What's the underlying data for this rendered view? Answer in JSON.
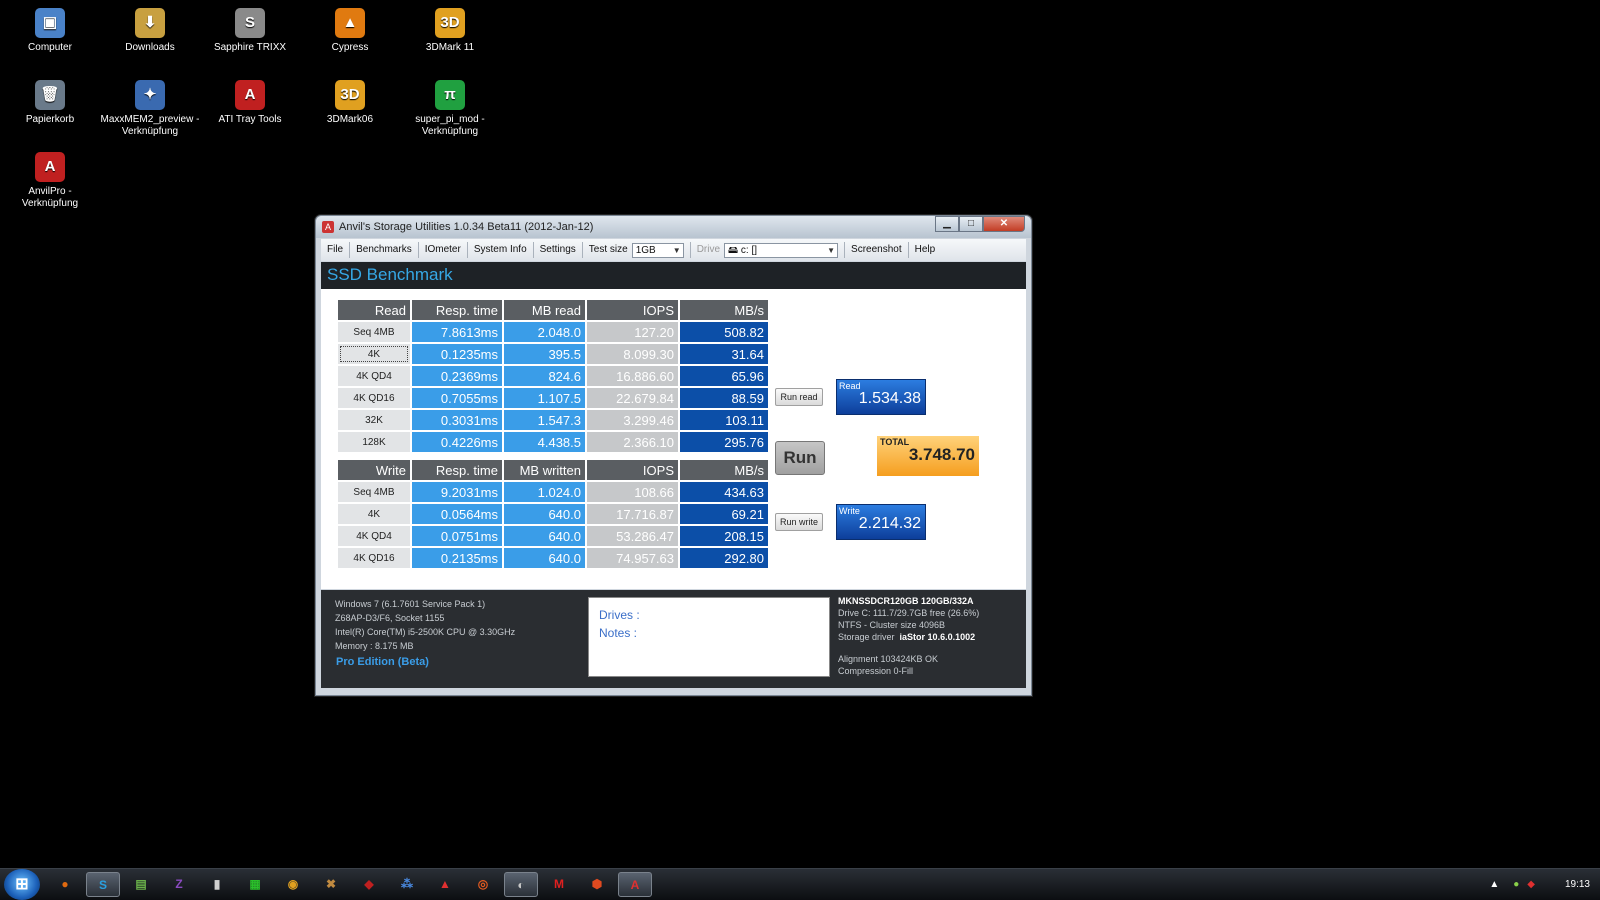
{
  "desktop": {
    "icons": [
      {
        "label": "Computer",
        "glyph": "▣",
        "color": "#4a82c8",
        "icon": "computer-icon"
      },
      {
        "label": "Downloads",
        "glyph": "⬇",
        "color": "#c8a040",
        "icon": "downloads-folder-icon"
      },
      {
        "label": "Sapphire TRIXX",
        "glyph": "S",
        "color": "#8a8a8a",
        "icon": "sapphire-trixx-icon"
      },
      {
        "label": "Cypress",
        "glyph": "▲",
        "color": "#e07a10",
        "icon": "vlc-cone-icon"
      },
      {
        "label": "3DMark 11",
        "glyph": "3D",
        "color": "#e0a020",
        "icon": "3dmark-icon"
      },
      {
        "label": "Papierkorb",
        "glyph": "🗑",
        "color": "#6a7a8a",
        "icon": "recycle-bin-icon"
      },
      {
        "label": "MaxxMEM2_preview - Verknüpfung",
        "glyph": "✦",
        "color": "#3a6ab0",
        "icon": "maxxmem-icon"
      },
      {
        "label": "ATI Tray Tools",
        "glyph": "A",
        "color": "#c02020",
        "icon": "ati-tray-tools-icon"
      },
      {
        "label": "3DMark06",
        "glyph": "3D",
        "color": "#e0a020",
        "icon": "3dmark06-icon"
      },
      {
        "label": "super_pi_mod - Verknüpfung",
        "glyph": "π",
        "color": "#20a040",
        "icon": "super-pi-icon"
      },
      {
        "label": "AnvilPro - Verknüpfung",
        "glyph": "A",
        "color": "#c02020",
        "icon": "anvilpro-icon"
      }
    ]
  },
  "window": {
    "title": "Anvil's Storage Utilities 1.0.34 Beta11 (2012-Jan-12)",
    "min": "▁",
    "max": "□",
    "close": "✕"
  },
  "menu": {
    "file": "File",
    "benchmarks": "Benchmarks",
    "iometer": "IOmeter",
    "sysinfo": "System Info",
    "settings": "Settings",
    "testsize_label": "Test size",
    "testsize_value": "1GB",
    "drive_label": "Drive",
    "drive_value": "c: []",
    "screenshot": "Screenshot",
    "help": "Help"
  },
  "header": {
    "title": "SSD Benchmark"
  },
  "read_table": {
    "headers": [
      "Read",
      "Resp. time",
      "MB read",
      "IOPS",
      "MB/s"
    ],
    "rows": [
      [
        "Seq 4MB",
        "7.8613ms",
        "2.048.0",
        "127.20",
        "508.82"
      ],
      [
        "4K",
        "0.1235ms",
        "395.5",
        "8.099.30",
        "31.64"
      ],
      [
        "4K QD4",
        "0.2369ms",
        "824.6",
        "16.886.60",
        "65.96"
      ],
      [
        "4K QD16",
        "0.7055ms",
        "1.107.5",
        "22.679.84",
        "88.59"
      ],
      [
        "32K",
        "0.3031ms",
        "1.547.3",
        "3.299.46",
        "103.11"
      ],
      [
        "128K",
        "0.4226ms",
        "4.438.5",
        "2.366.10",
        "295.76"
      ]
    ]
  },
  "write_table": {
    "headers": [
      "Write",
      "Resp. time",
      "MB written",
      "IOPS",
      "MB/s"
    ],
    "rows": [
      [
        "Seq 4MB",
        "9.2031ms",
        "1.024.0",
        "108.66",
        "434.63"
      ],
      [
        "4K",
        "0.0564ms",
        "640.0",
        "17.716.87",
        "69.21"
      ],
      [
        "4K QD4",
        "0.0751ms",
        "640.0",
        "53.286.47",
        "208.15"
      ],
      [
        "4K QD16",
        "0.2135ms",
        "640.0",
        "74.957.63",
        "292.80"
      ]
    ]
  },
  "buttons": {
    "run_read": "Run read",
    "run": "Run",
    "run_write": "Run write"
  },
  "scores": {
    "read_label": "Read",
    "read_value": "1.534.38",
    "total_label": "TOTAL",
    "total_value": "3.748.70",
    "write_label": "Write",
    "write_value": "2.214.32"
  },
  "sysinfo": {
    "os": "Windows 7 (6.1.7601 Service Pack 1)",
    "board": "Z68AP-D3/F6, Socket 1155",
    "cpu": "Intel(R) Core(TM) i5-2500K CPU @ 3.30GHz",
    "memory": "Memory : 8.175 MB",
    "edition": "Pro Edition (Beta)"
  },
  "notes": {
    "drives": "Drives :",
    "notes": "Notes :"
  },
  "driveinfo": {
    "model": "MKNSSDCR120GB 120GB/332A",
    "drive": "Drive C: 111.7/29.7GB free (26.6%)",
    "fs": "NTFS - Cluster size 4096B",
    "driver_label": "Storage driver",
    "driver_value": "iaStor 10.6.0.1002",
    "alignment": "Alignment 103424KB OK",
    "compression": "Compression 0-Fill"
  },
  "taskbar": {
    "start": "⊞",
    "items": [
      {
        "glyph": "●",
        "color": "#e06a10",
        "icon": "firefox-icon"
      },
      {
        "glyph": "S",
        "color": "#2aa0e0",
        "icon": "skype-icon"
      },
      {
        "glyph": "▤",
        "color": "#6ab04a",
        "icon": "taskbar-app-icon"
      },
      {
        "glyph": "Z",
        "color": "#8a4ac0",
        "icon": "z-app-icon"
      },
      {
        "glyph": "▮",
        "color": "#d0d0d0",
        "icon": "taskbar-app-icon"
      },
      {
        "glyph": "▦",
        "color": "#2ac02a",
        "icon": "gpu-z-icon"
      },
      {
        "glyph": "◉",
        "color": "#e0a020",
        "icon": "taskbar-app-icon"
      },
      {
        "glyph": "✖",
        "color": "#c08a40",
        "icon": "taskbar-app-icon"
      },
      {
        "glyph": "◆",
        "color": "#c02020",
        "icon": "taskbar-app-icon"
      },
      {
        "glyph": "⁂",
        "color": "#4a8ae0",
        "icon": "taskbar-app-icon"
      },
      {
        "glyph": "▲",
        "color": "#e03030",
        "icon": "taskbar-app-icon"
      },
      {
        "glyph": "◎",
        "color": "#e05a20",
        "icon": "taskbar-app-icon"
      },
      {
        "glyph": "◐",
        "color": "#c8c8c8",
        "icon": "taskbar-app-icon"
      },
      {
        "glyph": "M",
        "color": "#e02020",
        "icon": "taskbar-app-icon"
      },
      {
        "glyph": "⬢",
        "color": "#e04a20",
        "icon": "taskbar-app-icon"
      },
      {
        "glyph": "A",
        "color": "#e03030",
        "icon": "anvil-taskbar-icon"
      }
    ],
    "clock": "19:13"
  }
}
